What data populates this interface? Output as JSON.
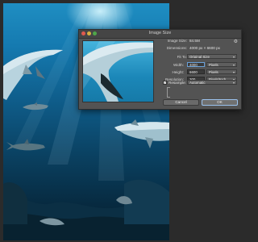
{
  "dialog": {
    "title": "Image Size",
    "image_size_label": "Image Size:",
    "image_size_value": "84.5M",
    "dimensions_label": "Dimensions:",
    "dimensions_value": "4000 px × 6600 px",
    "fit_to_label": "Fit To:",
    "fit_to_value": "Original Size",
    "width_label": "Width:",
    "width_value": "4000",
    "width_unit": "Pixels",
    "height_label": "Height:",
    "height_value": "6600",
    "height_unit": "Pixels",
    "resolution_label": "Resolution:",
    "resolution_value": "300",
    "resolution_unit": "Pixels/Inch",
    "resample_label": "Resample:",
    "resample_value": "Automatic",
    "resample_checked": true,
    "cancel_label": "Cancel",
    "ok_label": "OK"
  },
  "icons": {
    "gear": "gear-icon",
    "chain": "link-chain-icon",
    "check": "checkmark-icon",
    "chevron": "chevron-down-icon"
  },
  "colors": {
    "dialog_bg": "#535353",
    "field_bg": "#3a3a3a",
    "ok_focus": "#9cc3ee",
    "water_top": "#1f8ec2",
    "water_deep": "#051c2b"
  }
}
